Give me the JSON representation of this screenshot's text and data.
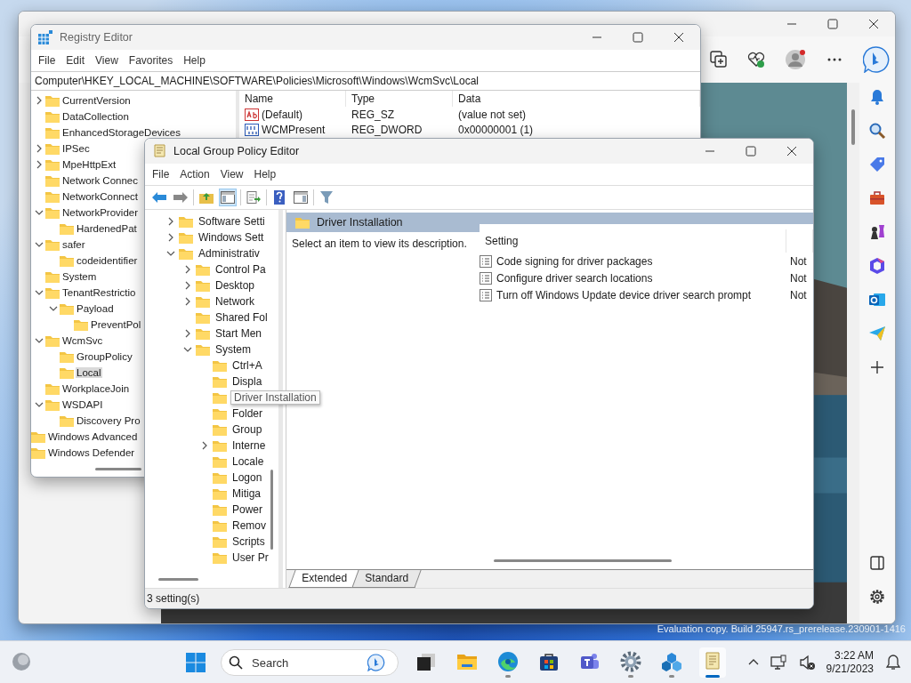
{
  "registry_editor": {
    "title": "Registry Editor",
    "menu": [
      "File",
      "Edit",
      "View",
      "Favorites",
      "Help"
    ],
    "address": "Computer\\HKEY_LOCAL_MACHINE\\SOFTWARE\\Policies\\Microsoft\\Windows\\WcmSvc\\Local",
    "tree": {
      "items": [
        {
          "label": "CurrentVersion",
          "kind": "collapsed",
          "selected": false
        },
        {
          "label": "DataCollection",
          "kind": "leaf",
          "selected": false
        },
        {
          "label": "EnhancedStorageDevices",
          "kind": "leaf",
          "selected": false
        },
        {
          "label": "IPSec",
          "kind": "collapsed",
          "selected": false
        },
        {
          "label": "MpeHttpExt",
          "kind": "collapsed",
          "selected": false
        },
        {
          "label": "Network Connec",
          "kind": "leaf",
          "selected": false
        },
        {
          "label": "NetworkConnect",
          "kind": "leaf",
          "selected": false
        },
        {
          "label": "NetworkProvider",
          "kind": "expanded",
          "selected": false,
          "children": [
            {
              "label": "HardenedPat",
              "kind": "leaf",
              "selected": false
            }
          ]
        },
        {
          "label": "safer",
          "kind": "expanded",
          "selected": false,
          "children": [
            {
              "label": "codeidentifier",
              "kind": "leaf",
              "selected": false
            }
          ]
        },
        {
          "label": "System",
          "kind": "leaf",
          "selected": false
        },
        {
          "label": "TenantRestrictio",
          "kind": "expanded",
          "selected": false,
          "children": [
            {
              "label": "Payload",
              "kind": "expanded",
              "selected": false,
              "children": [
                {
                  "label": "PreventPol",
                  "kind": "leaf",
                  "selected": false
                }
              ]
            }
          ]
        },
        {
          "label": "WcmSvc",
          "kind": "expanded",
          "selected": false,
          "children": [
            {
              "label": "GroupPolicy",
              "kind": "leaf",
              "selected": false
            },
            {
              "label": "Local",
              "kind": "leaf",
              "selected": true
            }
          ]
        },
        {
          "label": "WorkplaceJoin",
          "kind": "leaf",
          "selected": false
        },
        {
          "label": "WSDAPI",
          "kind": "expanded",
          "selected": false,
          "children": [
            {
              "label": "Discovery Pro",
              "kind": "leaf",
              "selected": false
            }
          ]
        }
      ],
      "parent_siblings": [
        {
          "label": "Windows Advanced",
          "selected": false
        },
        {
          "label": "Windows Defender",
          "selected": false
        }
      ]
    },
    "values": {
      "columns": [
        "Name",
        "Type",
        "Data"
      ],
      "rows": [
        {
          "kind": "string",
          "name": "(Default)",
          "type": "REG_SZ",
          "data": "(value not set)"
        },
        {
          "kind": "binary",
          "name": "WCMPresent",
          "type": "REG_DWORD",
          "data": "0x00000001 (1)"
        }
      ]
    }
  },
  "group_policy_editor": {
    "title": "Local Group Policy Editor",
    "menu": [
      "File",
      "Action",
      "View",
      "Help"
    ],
    "toolbar": [
      {
        "kind": "back",
        "pressed": false
      },
      {
        "kind": "forward",
        "pressed": false
      },
      {
        "kind": "up",
        "pressed": false
      },
      {
        "kind": "tree",
        "pressed": true
      },
      {
        "kind": "export",
        "pressed": false
      },
      {
        "kind": "help",
        "pressed": false
      },
      {
        "kind": "view",
        "pressed": false
      },
      {
        "kind": "filter",
        "pressed": false
      }
    ],
    "tree": [
      {
        "label": "Software Setti",
        "kind": "collapsed",
        "hovered": false
      },
      {
        "label": "Windows Sett",
        "kind": "collapsed",
        "hovered": false
      },
      {
        "label": "Administrativ",
        "kind": "expanded",
        "hovered": false,
        "children": [
          {
            "label": "Control Pa",
            "kind": "collapsed",
            "hovered": false
          },
          {
            "label": "Desktop",
            "kind": "collapsed",
            "hovered": false
          },
          {
            "label": "Network",
            "kind": "collapsed",
            "hovered": false
          },
          {
            "label": "Shared Fol",
            "kind": "leaf",
            "hovered": false
          },
          {
            "label": "Start Men",
            "kind": "collapsed",
            "hovered": false
          },
          {
            "label": "System",
            "kind": "expanded",
            "hovered": false,
            "children": [
              {
                "label": "Ctrl+A",
                "kind": "leaf",
                "hovered": false
              },
              {
                "label": "Displa",
                "kind": "leaf",
                "hovered": false
              },
              {
                "label": "Driver Installation",
                "kind": "leaf",
                "hovered": true
              },
              {
                "label": "Folder",
                "kind": "leaf",
                "hovered": false
              },
              {
                "label": "Group",
                "kind": "leaf",
                "hovered": false
              },
              {
                "label": "Interne",
                "kind": "collapsed",
                "hovered": false
              },
              {
                "label": "Locale",
                "kind": "leaf",
                "hovered": false
              },
              {
                "label": "Logon",
                "kind": "leaf",
                "hovered": false
              },
              {
                "label": "Mitiga",
                "kind": "leaf",
                "hovered": false
              },
              {
                "label": "Power",
                "kind": "leaf",
                "hovered": false
              },
              {
                "label": "Remov",
                "kind": "leaf",
                "hovered": false
              },
              {
                "label": "Scripts",
                "kind": "leaf",
                "hovered": false
              },
              {
                "label": "User Pr",
                "kind": "leaf",
                "hovered": false
              }
            ]
          }
        ]
      }
    ],
    "header": "Driver Installation",
    "description": "Select an item to view its description.",
    "settings": {
      "columns": [
        "Setting"
      ],
      "rows": [
        {
          "name": "Code signing for driver packages",
          "state": "Not"
        },
        {
          "name": "Configure driver search locations",
          "state": "Not"
        },
        {
          "name": "Turn off Windows Update device driver search prompt",
          "state": "Not"
        }
      ]
    },
    "tabs": [
      {
        "label": "Extended",
        "selected": true
      },
      {
        "label": "Standard",
        "selected": false
      }
    ],
    "status": "3 setting(s)"
  },
  "evaluation_notice": "Evaluation copy. Build 25947.rs_prerelease.230901-1416",
  "taskbar": {
    "search": {
      "placeholder": "Search"
    },
    "apps": [
      {
        "kind": "taskview",
        "running": false,
        "active": false
      },
      {
        "kind": "explorer",
        "running": false,
        "active": false
      },
      {
        "kind": "edge",
        "running": true,
        "active": false
      },
      {
        "kind": "store",
        "running": false,
        "active": false
      },
      {
        "kind": "teams",
        "running": false,
        "active": false
      },
      {
        "kind": "settings",
        "running": true,
        "active": false
      },
      {
        "kind": "cubes",
        "running": true,
        "active": false
      },
      {
        "kind": "policy",
        "running": true,
        "active": true
      }
    ],
    "time": "3:22 AM",
    "date": "9/21/2023"
  }
}
